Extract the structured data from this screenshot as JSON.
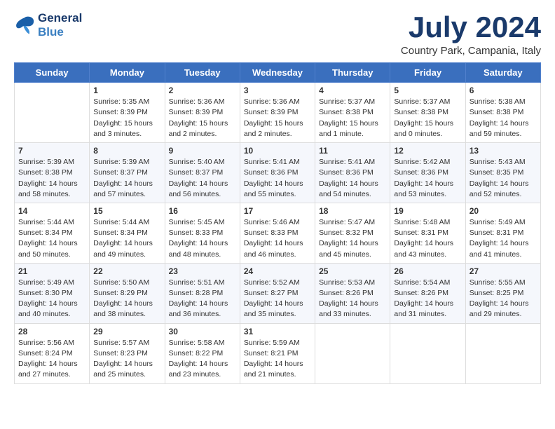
{
  "logo": {
    "line1": "General",
    "line2": "Blue"
  },
  "title": "July 2024",
  "location": "Country Park, Campania, Italy",
  "headers": [
    "Sunday",
    "Monday",
    "Tuesday",
    "Wednesday",
    "Thursday",
    "Friday",
    "Saturday"
  ],
  "weeks": [
    [
      {
        "day": "",
        "content": ""
      },
      {
        "day": "1",
        "content": "Sunrise: 5:35 AM\nSunset: 8:39 PM\nDaylight: 15 hours\nand 3 minutes."
      },
      {
        "day": "2",
        "content": "Sunrise: 5:36 AM\nSunset: 8:39 PM\nDaylight: 15 hours\nand 2 minutes."
      },
      {
        "day": "3",
        "content": "Sunrise: 5:36 AM\nSunset: 8:39 PM\nDaylight: 15 hours\nand 2 minutes."
      },
      {
        "day": "4",
        "content": "Sunrise: 5:37 AM\nSunset: 8:38 PM\nDaylight: 15 hours\nand 1 minute."
      },
      {
        "day": "5",
        "content": "Sunrise: 5:37 AM\nSunset: 8:38 PM\nDaylight: 15 hours\nand 0 minutes."
      },
      {
        "day": "6",
        "content": "Sunrise: 5:38 AM\nSunset: 8:38 PM\nDaylight: 14 hours\nand 59 minutes."
      }
    ],
    [
      {
        "day": "7",
        "content": "Sunrise: 5:39 AM\nSunset: 8:38 PM\nDaylight: 14 hours\nand 58 minutes."
      },
      {
        "day": "8",
        "content": "Sunrise: 5:39 AM\nSunset: 8:37 PM\nDaylight: 14 hours\nand 57 minutes."
      },
      {
        "day": "9",
        "content": "Sunrise: 5:40 AM\nSunset: 8:37 PM\nDaylight: 14 hours\nand 56 minutes."
      },
      {
        "day": "10",
        "content": "Sunrise: 5:41 AM\nSunset: 8:36 PM\nDaylight: 14 hours\nand 55 minutes."
      },
      {
        "day": "11",
        "content": "Sunrise: 5:41 AM\nSunset: 8:36 PM\nDaylight: 14 hours\nand 54 minutes."
      },
      {
        "day": "12",
        "content": "Sunrise: 5:42 AM\nSunset: 8:36 PM\nDaylight: 14 hours\nand 53 minutes."
      },
      {
        "day": "13",
        "content": "Sunrise: 5:43 AM\nSunset: 8:35 PM\nDaylight: 14 hours\nand 52 minutes."
      }
    ],
    [
      {
        "day": "14",
        "content": "Sunrise: 5:44 AM\nSunset: 8:34 PM\nDaylight: 14 hours\nand 50 minutes."
      },
      {
        "day": "15",
        "content": "Sunrise: 5:44 AM\nSunset: 8:34 PM\nDaylight: 14 hours\nand 49 minutes."
      },
      {
        "day": "16",
        "content": "Sunrise: 5:45 AM\nSunset: 8:33 PM\nDaylight: 14 hours\nand 48 minutes."
      },
      {
        "day": "17",
        "content": "Sunrise: 5:46 AM\nSunset: 8:33 PM\nDaylight: 14 hours\nand 46 minutes."
      },
      {
        "day": "18",
        "content": "Sunrise: 5:47 AM\nSunset: 8:32 PM\nDaylight: 14 hours\nand 45 minutes."
      },
      {
        "day": "19",
        "content": "Sunrise: 5:48 AM\nSunset: 8:31 PM\nDaylight: 14 hours\nand 43 minutes."
      },
      {
        "day": "20",
        "content": "Sunrise: 5:49 AM\nSunset: 8:31 PM\nDaylight: 14 hours\nand 41 minutes."
      }
    ],
    [
      {
        "day": "21",
        "content": "Sunrise: 5:49 AM\nSunset: 8:30 PM\nDaylight: 14 hours\nand 40 minutes."
      },
      {
        "day": "22",
        "content": "Sunrise: 5:50 AM\nSunset: 8:29 PM\nDaylight: 14 hours\nand 38 minutes."
      },
      {
        "day": "23",
        "content": "Sunrise: 5:51 AM\nSunset: 8:28 PM\nDaylight: 14 hours\nand 36 minutes."
      },
      {
        "day": "24",
        "content": "Sunrise: 5:52 AM\nSunset: 8:27 PM\nDaylight: 14 hours\nand 35 minutes."
      },
      {
        "day": "25",
        "content": "Sunrise: 5:53 AM\nSunset: 8:26 PM\nDaylight: 14 hours\nand 33 minutes."
      },
      {
        "day": "26",
        "content": "Sunrise: 5:54 AM\nSunset: 8:26 PM\nDaylight: 14 hours\nand 31 minutes."
      },
      {
        "day": "27",
        "content": "Sunrise: 5:55 AM\nSunset: 8:25 PM\nDaylight: 14 hours\nand 29 minutes."
      }
    ],
    [
      {
        "day": "28",
        "content": "Sunrise: 5:56 AM\nSunset: 8:24 PM\nDaylight: 14 hours\nand 27 minutes."
      },
      {
        "day": "29",
        "content": "Sunrise: 5:57 AM\nSunset: 8:23 PM\nDaylight: 14 hours\nand 25 minutes."
      },
      {
        "day": "30",
        "content": "Sunrise: 5:58 AM\nSunset: 8:22 PM\nDaylight: 14 hours\nand 23 minutes."
      },
      {
        "day": "31",
        "content": "Sunrise: 5:59 AM\nSunset: 8:21 PM\nDaylight: 14 hours\nand 21 minutes."
      },
      {
        "day": "",
        "content": ""
      },
      {
        "day": "",
        "content": ""
      },
      {
        "day": "",
        "content": ""
      }
    ]
  ]
}
